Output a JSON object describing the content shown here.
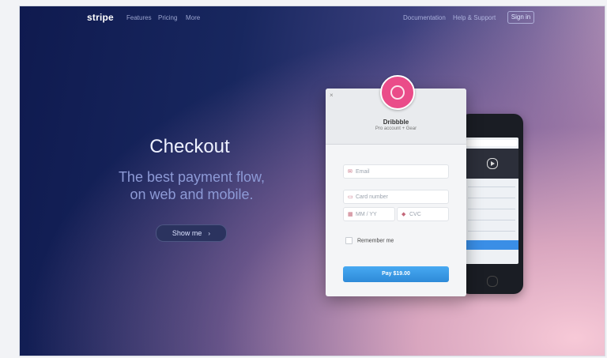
{
  "nav": {
    "logo": "stripe",
    "links": [
      "Features",
      "Pricing",
      "More"
    ],
    "right_links": [
      "Documentation",
      "Help & Support"
    ],
    "signin": "Sign in"
  },
  "hero": {
    "title": "Checkout",
    "subtitle_line1": "The best payment flow,",
    "subtitle_line2": "on web and mobile.",
    "cta": "Show me",
    "cta_arrow": "›"
  },
  "checkout": {
    "close": "×",
    "store_name": "Dribbble",
    "description": "Pro account + Gear",
    "email_placeholder": "Email",
    "card_placeholder": "Card number",
    "expiry_placeholder": "MM / YY",
    "cvc_placeholder": "CVC",
    "remember": "Remember me",
    "pay_button": "Pay $19.00"
  },
  "colors": {
    "brand_pink": "#ea4c89",
    "pay_blue": "#2d8ad8",
    "bg_dark": "#0f1a4f"
  }
}
